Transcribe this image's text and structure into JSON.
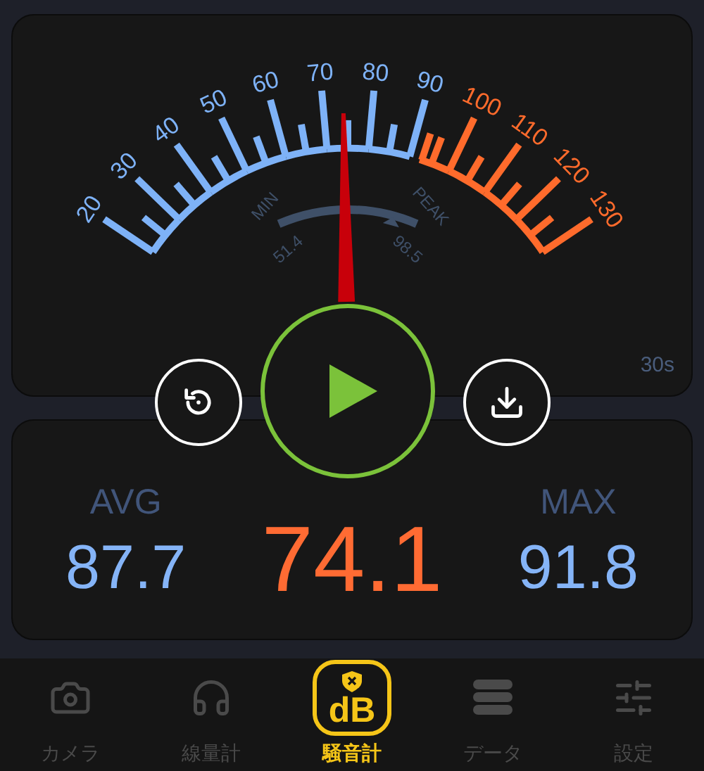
{
  "gauge": {
    "scale": [
      {
        "label": "20",
        "color": "#7eb2f7"
      },
      {
        "label": "30",
        "color": "#7eb2f7"
      },
      {
        "label": "40",
        "color": "#7eb2f7"
      },
      {
        "label": "50",
        "color": "#7eb2f7"
      },
      {
        "label": "60",
        "color": "#7eb2f7"
      },
      {
        "label": "70",
        "color": "#7eb2f7"
      },
      {
        "label": "80",
        "color": "#7eb2f7"
      },
      {
        "label": "90",
        "color": "#7eb2f7"
      },
      {
        "label": "100",
        "color": "#ff6b2c"
      },
      {
        "label": "110",
        "color": "#ff6b2c"
      },
      {
        "label": "120",
        "color": "#ff6b2c"
      },
      {
        "label": "130",
        "color": "#ff6b2c"
      }
    ],
    "min_label": "MIN",
    "peak_label": "PEAK",
    "min_value": "51.4",
    "peak_value": "98.5",
    "duration": "30s"
  },
  "stats": {
    "avg_label": "AVG",
    "avg_value": "87.7",
    "current_value": "74.1",
    "max_label": "MAX",
    "max_value": "91.8"
  },
  "tabs": [
    {
      "kind": "camera",
      "label": "カメラ",
      "selected": false
    },
    {
      "kind": "headphones",
      "label": "線量計",
      "selected": false
    },
    {
      "kind": "db",
      "label": "騒音計",
      "icon_text": "dB",
      "selected": true
    },
    {
      "kind": "list",
      "label": "データ",
      "selected": false
    },
    {
      "kind": "sliders",
      "label": "設定",
      "selected": false
    }
  ]
}
